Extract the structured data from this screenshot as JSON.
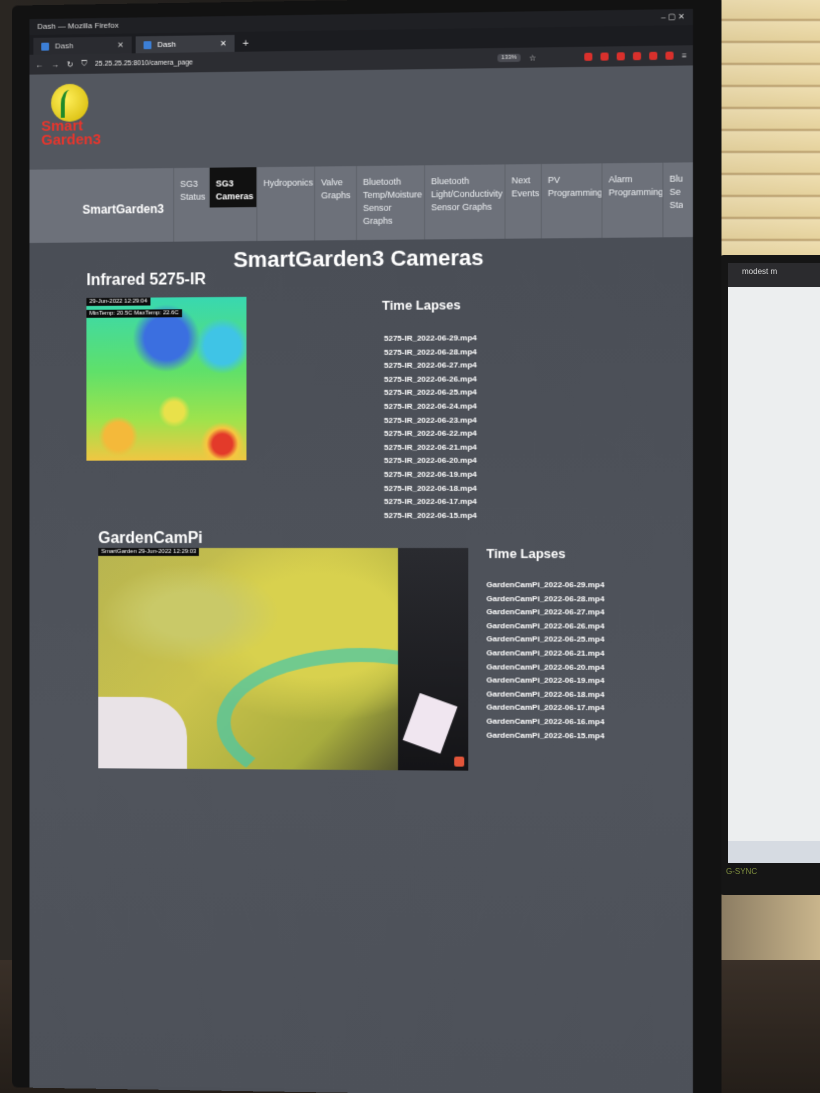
{
  "browser": {
    "window_title": "Dash — Mozilla Firefox",
    "tabs": [
      {
        "label": "Dash",
        "active": false
      },
      {
        "label": "Dash",
        "active": true
      }
    ],
    "new_tab": "+",
    "url": "25.25.25.25:8010/camera_page",
    "zoom": "133%",
    "window_controls": "– ▢ ✕"
  },
  "site": {
    "logo_text": "Smart Garden3",
    "brand": "SmartGarden3",
    "nav": [
      {
        "label": "SG3 Status",
        "active": false
      },
      {
        "label": "SG3 Cameras",
        "active": true
      },
      {
        "label": "Hydroponics",
        "active": false
      },
      {
        "label": "Valve Graphs",
        "active": false
      },
      {
        "label": "Bluetooth Temp/Moisture Sensor Graphs",
        "active": false
      },
      {
        "label": "Bluetooth Light/Conductivity Sensor Graphs",
        "active": false
      },
      {
        "label": "Next Events",
        "active": false
      },
      {
        "label": "PV Programming",
        "active": false
      },
      {
        "label": "Alarm Programming",
        "active": false
      },
      {
        "label": "Blu Se Sta",
        "active": false
      }
    ]
  },
  "page": {
    "title": "SmartGarden3 Cameras",
    "cameras": [
      {
        "title": "Infrared 5275-IR",
        "overlay_date": "29-Jun-2022 12:29:04",
        "overlay_temps": "MinTemp: 20.5C MaxTemp: 22.6C",
        "timelapse_title": "Time Lapses",
        "timelapses": [
          "5275-IR_2022-06-29.mp4",
          "5275-IR_2022-06-28.mp4",
          "5275-IR_2022-06-27.mp4",
          "5275-IR_2022-06-26.mp4",
          "5275-IR_2022-06-25.mp4",
          "5275-IR_2022-06-24.mp4",
          "5275-IR_2022-06-23.mp4",
          "5275-IR_2022-06-22.mp4",
          "5275-IR_2022-06-21.mp4",
          "5275-IR_2022-06-20.mp4",
          "5275-IR_2022-06-19.mp4",
          "5275-IR_2022-06-18.mp4",
          "5275-IR_2022-06-17.mp4",
          "5275-IR_2022-06-15.mp4"
        ]
      },
      {
        "title": "GardenCamPi",
        "overlay_date": "SmartGarden 29-Jun-2022 12:29:03",
        "timelapse_title": "Time Lapses",
        "timelapses": [
          "GardenCamPi_2022-06-29.mp4",
          "GardenCamPi_2022-06-28.mp4",
          "GardenCamPi_2022-06-27.mp4",
          "GardenCamPi_2022-06-26.mp4",
          "GardenCamPi_2022-06-25.mp4",
          "GardenCamPi_2022-06-21.mp4",
          "GardenCamPi_2022-06-20.mp4",
          "GardenCamPi_2022-06-19.mp4",
          "GardenCamPi_2022-06-18.mp4",
          "GardenCamPi_2022-06-17.mp4",
          "GardenCamPi_2022-06-16.mp4",
          "GardenCamPi_2022-06-15.mp4"
        ]
      }
    ]
  },
  "side_monitor": {
    "tab_label": "modest m",
    "label": "G-SYNC"
  },
  "colors": {
    "page_bg": "#4f535b",
    "nav_bg": "#6d717a",
    "nav_active_bg": "#111111",
    "logo_red": "#e8352c",
    "logo_yellow": "#ffef5a"
  }
}
